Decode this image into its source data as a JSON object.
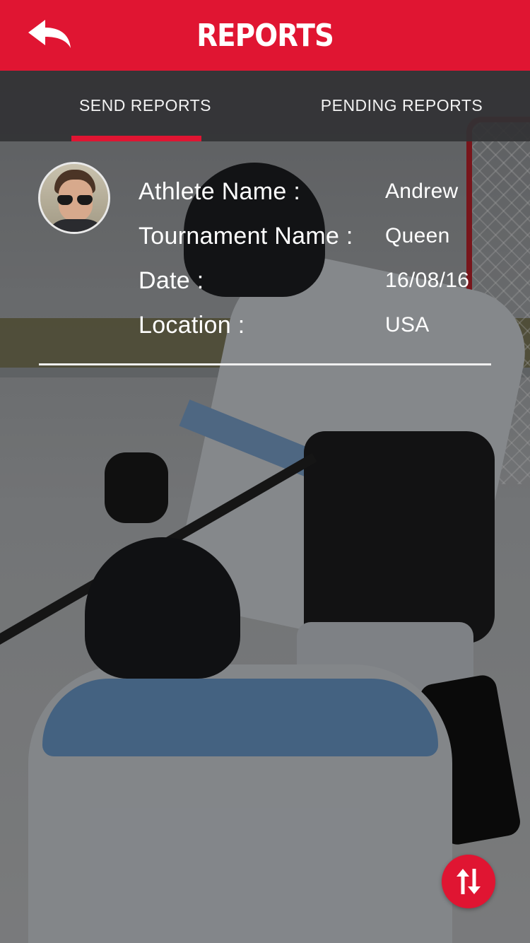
{
  "header": {
    "title": "REPORTS",
    "back_icon": "back-arrow-icon",
    "accent_color": "#e01532"
  },
  "tabs": [
    {
      "label": "SEND REPORTS",
      "active": true
    },
    {
      "label": "PENDING REPORTS",
      "active": false
    }
  ],
  "report": {
    "avatar_icon": "user-avatar",
    "fields": [
      {
        "label": "Athlete Name :",
        "value": "Andrew"
      },
      {
        "label": "Tournament Name :",
        "value": "Queen"
      },
      {
        "label": "Date :",
        "value": "16/08/16"
      },
      {
        "label": "Location :",
        "value": "USA"
      }
    ]
  },
  "fab": {
    "icon": "sort-arrows-icon"
  }
}
